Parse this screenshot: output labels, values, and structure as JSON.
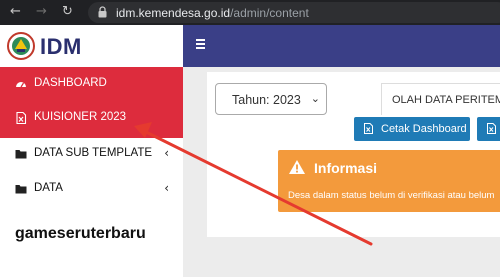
{
  "browser": {
    "url_host": "idm.kemendesa.go.id",
    "url_path": "/admin/content"
  },
  "app": {
    "logo_text": "IDM"
  },
  "sidebar": {
    "items": [
      {
        "label": "DASHBOARD",
        "icon": "dashboard-icon"
      },
      {
        "label": "KUISIONER 2023",
        "icon": "file-excel-icon"
      },
      {
        "label": "DATA SUB TEMPLATE",
        "icon": "folder-icon",
        "chevron": "‹"
      },
      {
        "label": "DATA",
        "icon": "folder-icon",
        "chevron": "‹"
      }
    ]
  },
  "watermark": "gameseruterbaru",
  "content": {
    "year_select": "Tahun: 2023",
    "tab_label": "OLAH DATA PERITEM",
    "cetak_button": "Cetak Dashboard",
    "alert": {
      "title": "Informasi",
      "message": "Desa dalam status belum di verifikasi atau belum"
    }
  },
  "colors": {
    "sidebar_active": "#dd2c3d",
    "topbar": "#3a3f87",
    "button": "#1f7bb6",
    "alert": "#f39a3c",
    "annotation_arrow": "#e53a2f"
  }
}
